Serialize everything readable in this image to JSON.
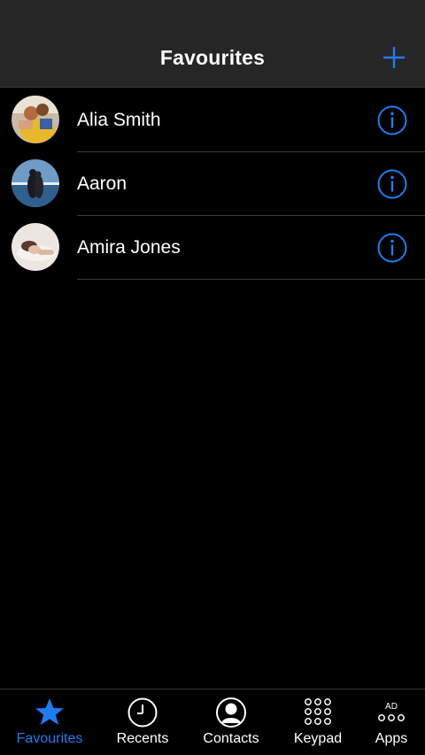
{
  "header": {
    "title": "Favourites"
  },
  "contacts": [
    {
      "name": "Alia Smith"
    },
    {
      "name": "Aaron"
    },
    {
      "name": "Amira Jones"
    }
  ],
  "tabs": [
    {
      "label": "Favourites",
      "icon": "star-icon",
      "active": true
    },
    {
      "label": "Recents",
      "icon": "clock-icon",
      "active": false
    },
    {
      "label": "Contacts",
      "icon": "person-icon",
      "active": false
    },
    {
      "label": "Keypad",
      "icon": "keypad-icon",
      "active": false
    },
    {
      "label": "Apps",
      "icon": "apps-icon",
      "active": false,
      "badge": "AD"
    }
  ],
  "colors": {
    "accent": "#1e7cf2",
    "header_bg": "#262626",
    "background": "#000000"
  }
}
